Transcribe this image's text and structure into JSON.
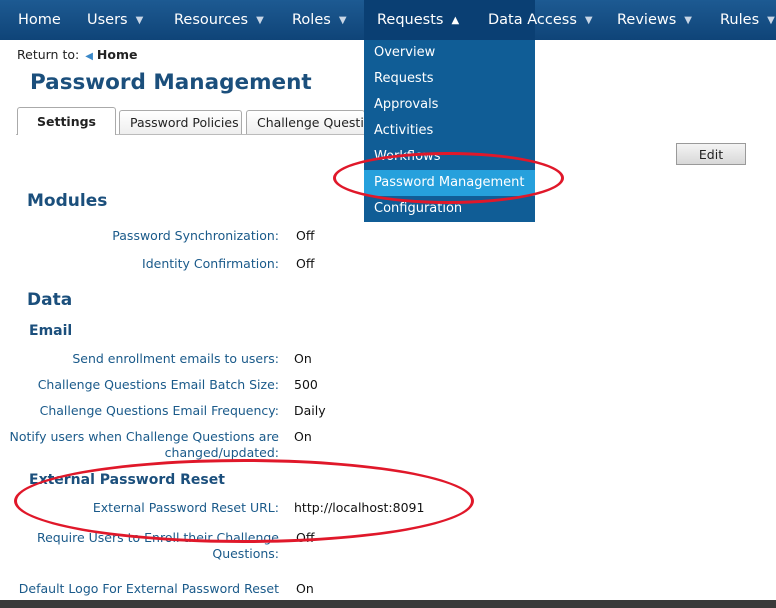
{
  "nav": {
    "items": [
      {
        "label": "Home",
        "caret": false
      },
      {
        "label": "Users",
        "caret": true
      },
      {
        "label": "Resources",
        "caret": true
      },
      {
        "label": "Roles",
        "caret": true
      },
      {
        "label": "Requests",
        "caret": true,
        "active": true
      },
      {
        "label": "Data Access",
        "caret": true
      },
      {
        "label": "Reviews",
        "caret": true
      },
      {
        "label": "Rules",
        "caret": true
      }
    ],
    "caret_down": "▼",
    "caret_up": "▲"
  },
  "dropdown": {
    "items": [
      "Overview",
      "Requests",
      "Approvals",
      "Activities",
      "Workflows",
      "Password Management",
      "Configuration"
    ],
    "highlighted": "Password Management"
  },
  "return": {
    "label": "Return to:",
    "link": "Home"
  },
  "page_title": "Password Management",
  "tabs": [
    "Settings",
    "Password Policies",
    "Challenge Questions"
  ],
  "edit_label": "Edit",
  "modules": {
    "heading": "Modules",
    "rows": [
      {
        "label": "Password Synchronization:",
        "value": "Off"
      },
      {
        "label": "Identity Confirmation:",
        "value": "Off"
      }
    ]
  },
  "data": {
    "heading": "Data",
    "email": {
      "heading": "Email",
      "rows": [
        {
          "label": "Send enrollment emails to users:",
          "value": "On"
        },
        {
          "label": "Challenge Questions Email Batch Size:",
          "value": "500"
        },
        {
          "label": "Challenge Questions Email Frequency:",
          "value": "Daily"
        },
        {
          "label_line1": "Notify users when Challenge Questions are",
          "label_line2": "changed/updated:",
          "value": "On"
        }
      ]
    },
    "external": {
      "heading": "External Password Reset",
      "rows": [
        {
          "label": "External Password Reset URL:",
          "value": "http://localhost:8091"
        },
        {
          "label_line1": "Require Users to Enroll their Challenge",
          "label_line2": "Questions:",
          "value": "Off"
        },
        {
          "label": "Default Logo For External Password Reset",
          "value": "On"
        }
      ]
    }
  },
  "colors": {
    "nav_bg": "#0f4478",
    "dropdown_bg": "#105d96",
    "highlight": "#26a0dc",
    "annotation": "#e0182a",
    "heading": "#1b4f7c"
  }
}
